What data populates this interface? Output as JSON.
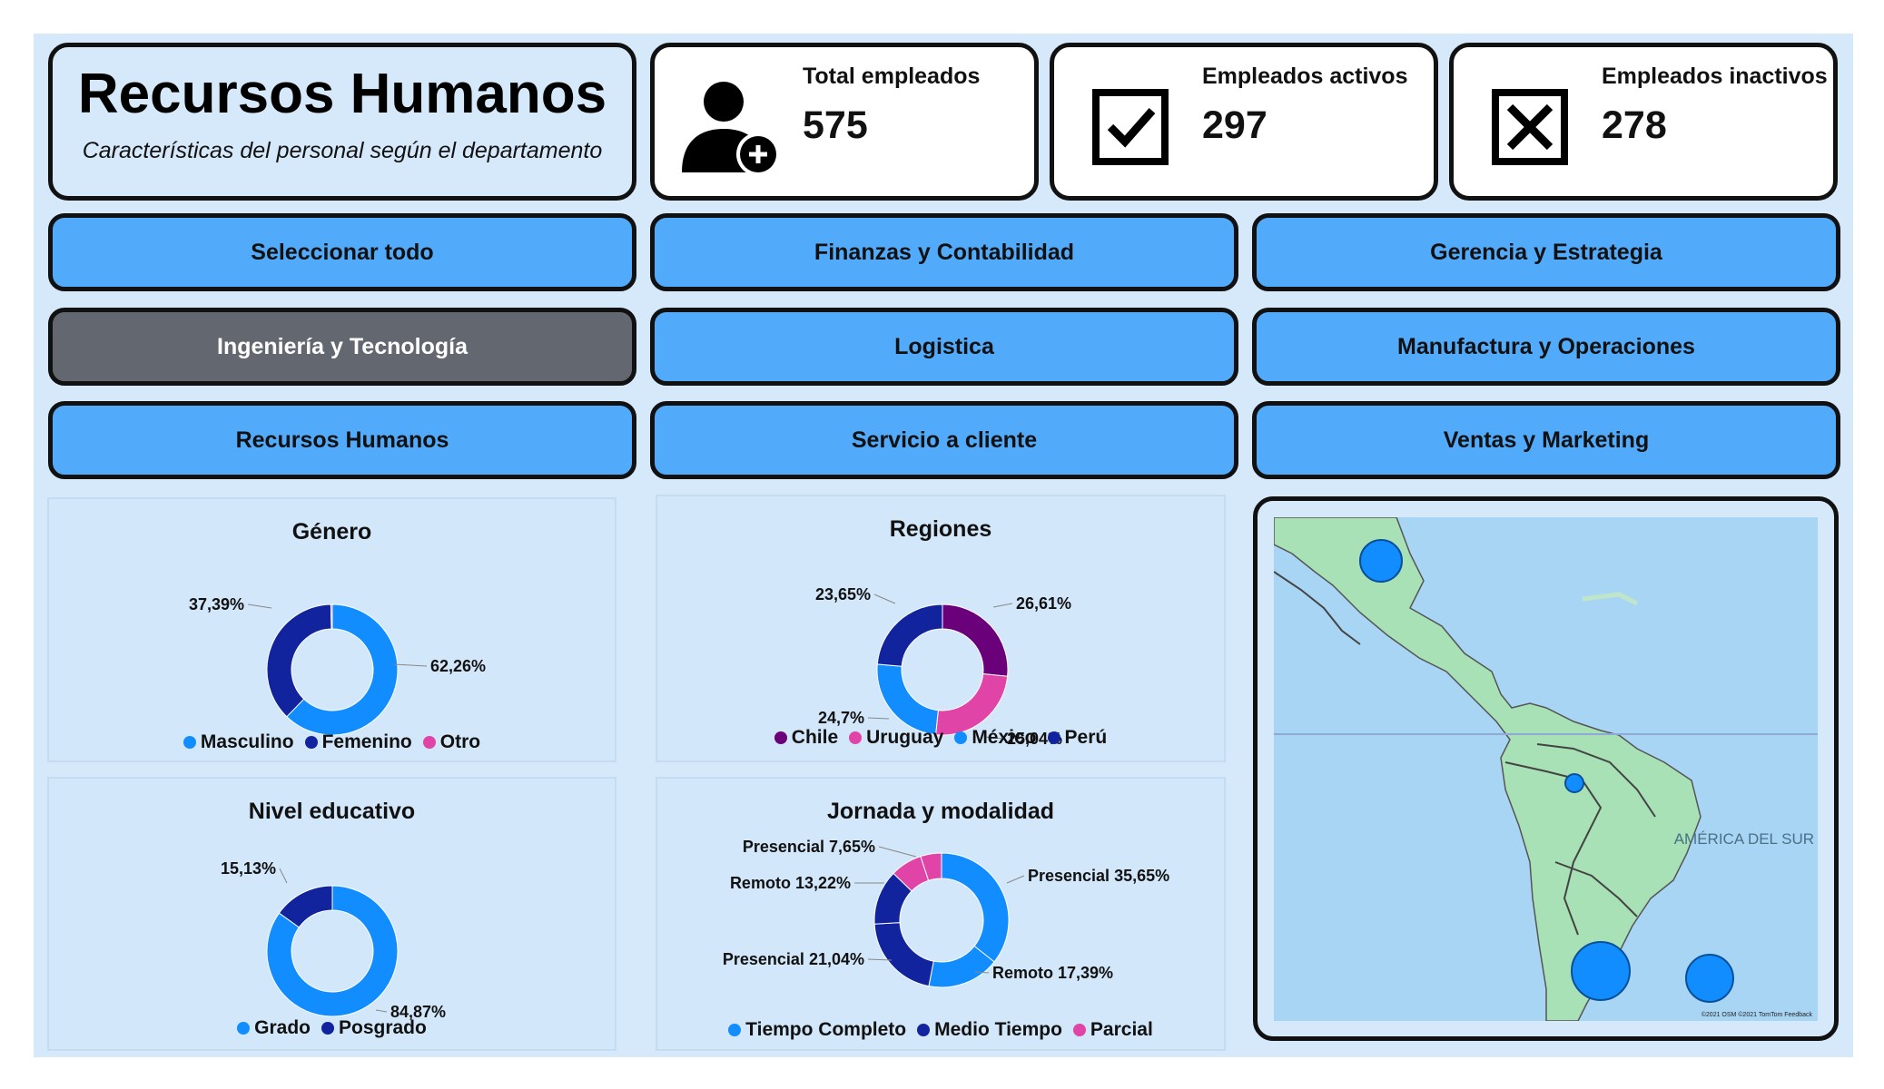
{
  "header": {
    "title": "Recursos Humanos",
    "subtitle": "Características del personal según el departamento"
  },
  "kpis": [
    {
      "label": "Total empleados",
      "value": "575",
      "icon": "add-user-icon"
    },
    {
      "label": "Empleados activos",
      "value": "297",
      "icon": "checkbox-checked-icon"
    },
    {
      "label": "Empleados inactivos",
      "value": "278",
      "icon": "checkbox-x-icon"
    }
  ],
  "buttons": [
    {
      "label": "Seleccionar todo",
      "selected": false
    },
    {
      "label": "Finanzas y Contabilidad",
      "selected": false
    },
    {
      "label": "Gerencia y Estrategia",
      "selected": false
    },
    {
      "label": "Ingeniería y Tecnología",
      "selected": true
    },
    {
      "label": "Logistica",
      "selected": false
    },
    {
      "label": "Manufactura y Operaciones",
      "selected": false
    },
    {
      "label": "Recursos Humanos",
      "selected": false
    },
    {
      "label": "Servicio a cliente",
      "selected": false
    },
    {
      "label": "Ventas y Marketing",
      "selected": false
    }
  ],
  "colors": {
    "button": "#52aafb",
    "button_selected": "#636870",
    "background": "#d6e9fb",
    "blue": "#118dff",
    "navy": "#12239e",
    "pink": "#e044a7",
    "purple": "#6b007b"
  },
  "map": {
    "label": "AMÉRICA DEL SUR",
    "credit": "©2021 OSM ©2021 TomTom Feedback"
  },
  "chart_data": [
    {
      "type": "pie",
      "title": "Género",
      "labels": [
        "Masculino",
        "Femenino",
        "Otro"
      ],
      "values": [
        62.26,
        37.39,
        0.35
      ],
      "data_labels": [
        "62,26%",
        "37,39%",
        ""
      ],
      "colors": [
        "#118dff",
        "#12239e",
        "#e044a7"
      ]
    },
    {
      "type": "pie",
      "title": "Regiones",
      "labels": [
        "Chile",
        "Uruguay",
        "México",
        "Perú"
      ],
      "values": [
        26.61,
        25.04,
        24.7,
        23.65
      ],
      "data_labels": [
        "26,61%",
        "25,04%",
        "24,7%",
        "23,65%"
      ],
      "colors": [
        "#6b007b",
        "#e044a7",
        "#118dff",
        "#12239e"
      ]
    },
    {
      "type": "pie",
      "title": "Nivel educativo",
      "labels": [
        "Grado",
        "Posgrado"
      ],
      "values": [
        84.87,
        15.13
      ],
      "data_labels": [
        "84,87%",
        "15,13%"
      ],
      "colors": [
        "#118dff",
        "#12239e"
      ]
    },
    {
      "type": "pie",
      "title": "Jornada y modalidad",
      "legend": [
        "Tiempo Completo",
        "Medio Tiempo",
        "Parcial"
      ],
      "legend_colors": [
        "#118dff",
        "#12239e",
        "#e044a7"
      ],
      "values": [
        35.65,
        17.39,
        21.04,
        13.22,
        7.65,
        5.05
      ],
      "data_labels": [
        "Presencial 35,65%",
        "Remoto 17,39%",
        "Presencial 21,04%",
        "Remoto 13,22%",
        "Presencial 7,65%",
        ""
      ],
      "colors": [
        "#118dff",
        "#118dff",
        "#12239e",
        "#12239e",
        "#e044a7",
        "#e044a7"
      ]
    }
  ]
}
